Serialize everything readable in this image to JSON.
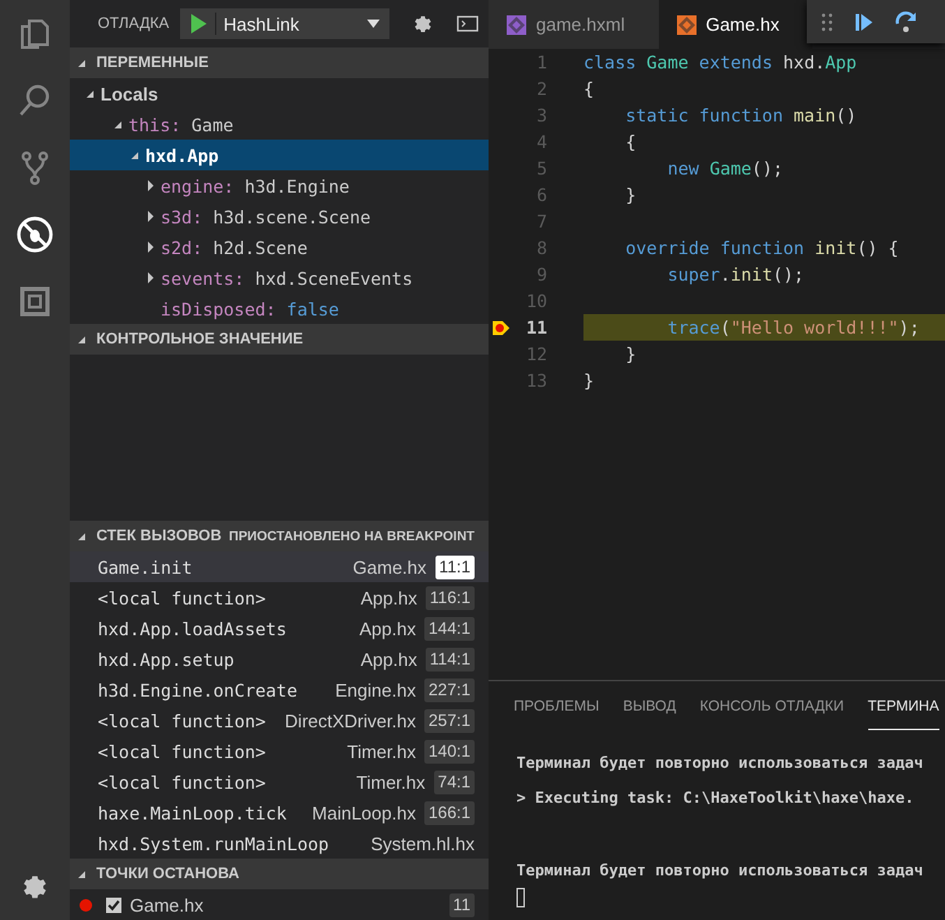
{
  "activity_bar": {
    "items": [
      {
        "selected": false
      },
      {
        "selected": false
      },
      {
        "selected": false
      },
      {
        "selected": true
      },
      {
        "selected": false
      }
    ]
  },
  "debug_header": {
    "title": "ОТЛАДКА",
    "configuration": "HashLink"
  },
  "variables": {
    "title": "ПЕРЕМЕННЫЕ",
    "expanded": true,
    "scopes": [
      {
        "label": "Locals",
        "expanded": true,
        "children": [
          {
            "name": "this:",
            "value": "Game",
            "kind": "object",
            "expanded": true,
            "selected": false,
            "children": [
              {
                "name": "hxd.App",
                "kind": "object",
                "expanded": true,
                "selected": true,
                "children": [
                  {
                    "name": "engine:",
                    "value": "h3d.Engine",
                    "kind": "object",
                    "expanded": false,
                    "selected": false
                  },
                  {
                    "name": "s3d:",
                    "value": "h3d.scene.Scene",
                    "kind": "object",
                    "expanded": false,
                    "selected": false
                  },
                  {
                    "name": "s2d:",
                    "value": "h2d.Scene",
                    "kind": "object",
                    "expanded": false,
                    "selected": false
                  },
                  {
                    "name": "sevents:",
                    "value": "hxd.SceneEvents",
                    "kind": "object",
                    "expanded": false,
                    "selected": false
                  },
                  {
                    "name": "isDisposed:",
                    "value": "false",
                    "kind": "boolean",
                    "selected": false
                  }
                ]
              }
            ]
          }
        ]
      }
    ]
  },
  "watch": {
    "title": "КОНТРОЛЬНОЕ ЗНАЧЕНИЕ",
    "expanded": true
  },
  "call_stack": {
    "title": "СТЕК ВЫЗОВОВ",
    "status": "ПРИОСТАНОВЛЕНО НА BREAKPOINT",
    "expanded": true,
    "frames": [
      {
        "name": "Game.init",
        "file": "Game.hx",
        "position": "11:1",
        "selected": true
      },
      {
        "name": "<local function>",
        "file": "App.hx",
        "position": "116:1",
        "selected": false
      },
      {
        "name": "hxd.App.loadAssets",
        "file": "App.hx",
        "position": "144:1",
        "selected": false
      },
      {
        "name": "hxd.App.setup",
        "file": "App.hx",
        "position": "114:1",
        "selected": false
      },
      {
        "name": "h3d.Engine.onCreate",
        "file": "Engine.hx",
        "position": "227:1",
        "selected": false
      },
      {
        "name": "<local function>",
        "file": "DirectXDriver.hx",
        "position": "257:1",
        "selected": false
      },
      {
        "name": "<local function>",
        "file": "Timer.hx",
        "position": "140:1",
        "selected": false
      },
      {
        "name": "<local function>",
        "file": "Timer.hx",
        "position": "74:1",
        "selected": false
      },
      {
        "name": "haxe.MainLoop.tick",
        "file": "MainLoop.hx",
        "position": "166:1",
        "selected": false
      },
      {
        "name": "hxd.System.runMainLoop",
        "file": "System.hl.hx",
        "selected": false
      }
    ]
  },
  "breakpoints": {
    "title": "ТОЧКИ ОСТАНОВА",
    "expanded": true,
    "items": [
      {
        "file": "Game.hx",
        "line": "11",
        "checked": true,
        "color": "#e51400"
      }
    ]
  },
  "editor_tabs": [
    {
      "label": "game.hxml",
      "selected": false,
      "color": "#8e5ec9"
    },
    {
      "label": "Game.hx",
      "selected": true,
      "color": "#e8702a"
    }
  ],
  "code_lines": [
    {
      "number": "1",
      "current": false,
      "breakpoint": false,
      "tokens": [
        {
          "kind": "keyword",
          "text": "class "
        },
        {
          "kind": "type",
          "text": "Game "
        },
        {
          "kind": "keyword",
          "text": "extends "
        },
        {
          "kind": "plain",
          "text": "hxd."
        },
        {
          "kind": "type",
          "text": "App"
        }
      ]
    },
    {
      "number": "2",
      "current": false,
      "breakpoint": false,
      "tokens": [
        {
          "kind": "plain",
          "text": "{"
        }
      ]
    },
    {
      "number": "3",
      "current": false,
      "breakpoint": false,
      "tokens": [
        {
          "kind": "keyword",
          "text": "    static function "
        },
        {
          "kind": "function",
          "text": "main"
        },
        {
          "kind": "plain",
          "text": "()"
        }
      ]
    },
    {
      "number": "4",
      "current": false,
      "breakpoint": false,
      "tokens": [
        {
          "kind": "plain",
          "text": "    {"
        }
      ]
    },
    {
      "number": "5",
      "current": false,
      "breakpoint": false,
      "tokens": [
        {
          "kind": "keyword",
          "text": "        new "
        },
        {
          "kind": "type",
          "text": "Game"
        },
        {
          "kind": "plain",
          "text": "();"
        }
      ]
    },
    {
      "number": "6",
      "current": false,
      "breakpoint": false,
      "tokens": [
        {
          "kind": "plain",
          "text": "    }"
        }
      ]
    },
    {
      "number": "7",
      "current": false,
      "breakpoint": false
    },
    {
      "number": "8",
      "current": false,
      "breakpoint": false,
      "tokens": [
        {
          "kind": "keyword",
          "text": "    override function "
        },
        {
          "kind": "function",
          "text": "init"
        },
        {
          "kind": "plain",
          "text": "() {"
        }
      ]
    },
    {
      "number": "9",
      "current": false,
      "breakpoint": false,
      "tokens": [
        {
          "kind": "keyword",
          "text": "        super"
        },
        {
          "kind": "plain",
          "text": "."
        },
        {
          "kind": "function",
          "text": "init"
        },
        {
          "kind": "plain",
          "text": "();"
        }
      ]
    },
    {
      "number": "10",
      "current": false,
      "breakpoint": false
    },
    {
      "number": "11",
      "current": true,
      "breakpoint": true,
      "tokens": [
        {
          "kind": "keyword",
          "text": "        trace"
        },
        {
          "kind": "plain",
          "text": "("
        },
        {
          "kind": "string",
          "text": "\"Hello world!!!\""
        },
        {
          "kind": "plain",
          "text": ");"
        }
      ]
    },
    {
      "number": "12",
      "current": false,
      "breakpoint": false,
      "tokens": [
        {
          "kind": "plain",
          "text": "    }"
        }
      ]
    },
    {
      "number": "13",
      "current": false,
      "breakpoint": false,
      "tokens": [
        {
          "kind": "plain",
          "text": "}"
        }
      ]
    }
  ],
  "panel_tabs": [
    {
      "label": "ПРОБЛЕМЫ",
      "selected": false
    },
    {
      "label": "ВЫВОД",
      "selected": false
    },
    {
      "label": "КОНСОЛЬ ОТЛАДКИ",
      "selected": false
    },
    {
      "label": "ТЕРМИНА",
      "selected": true
    }
  ],
  "terminal": {
    "lines": [
      "Терминал будет повторно использоваться задач",
      "> Executing task: C:\\HaxeToolkit\\haxe\\haxe.",
      "Терминал будет повторно использоваться задач"
    ]
  }
}
